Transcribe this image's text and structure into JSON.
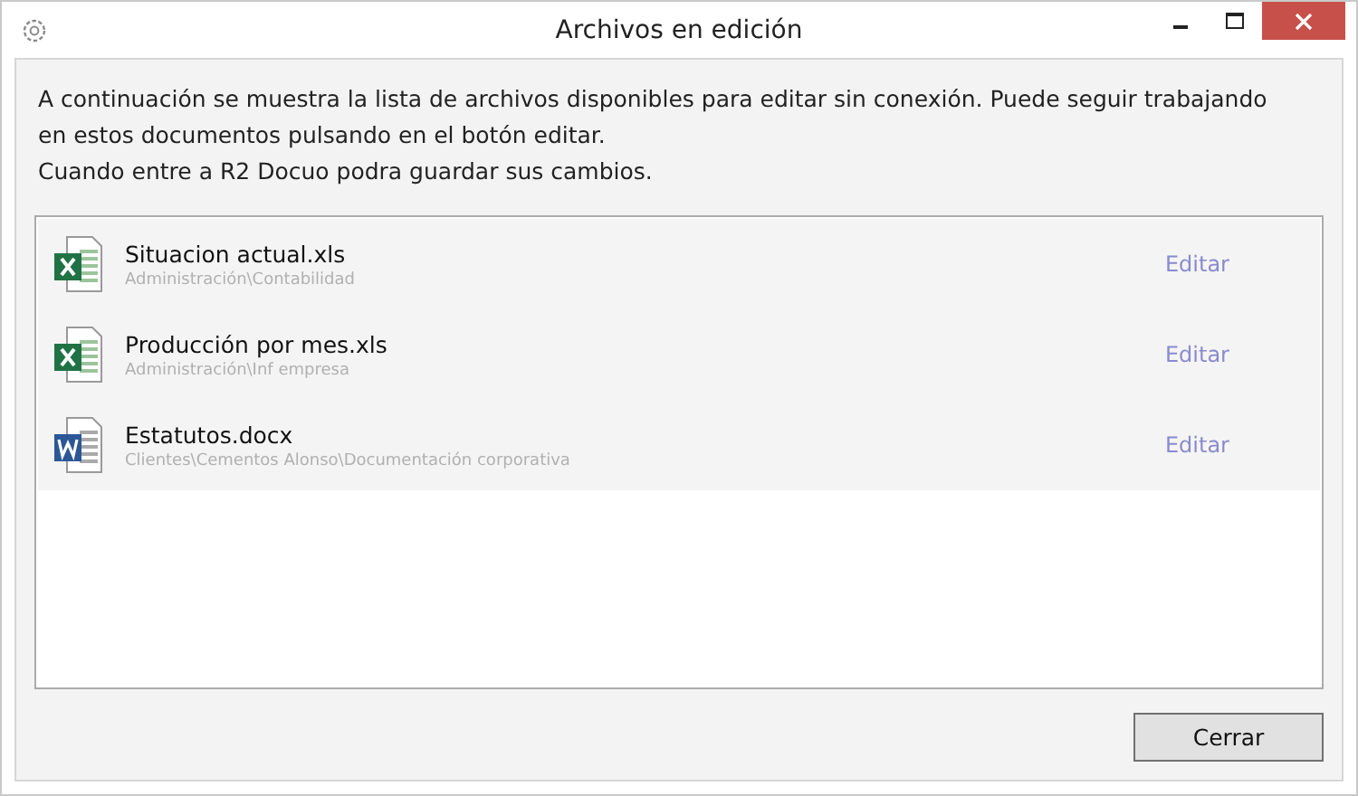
{
  "window": {
    "title": "Archivos en edición"
  },
  "intro": [
    "A continuación se muestra la lista de archivos disponibles para editar sin conexión. Puede seguir trabajando en estos documentos pulsando en el botón editar.",
    "Cuando entre a R2 Docuo podra guardar sus cambios."
  ],
  "files": [
    {
      "kind": "excel",
      "name": "Situacion actual.xls",
      "path": "Administración\\Contabilidad",
      "action": "Editar"
    },
    {
      "kind": "excel",
      "name": "Producción por mes.xls",
      "path": "Administración\\Inf empresa",
      "action": "Editar"
    },
    {
      "kind": "word",
      "name": "Estatutos.docx",
      "path": "Clientes\\Cementos Alonso\\Documentación corporativa",
      "action": "Editar"
    }
  ],
  "close_button": "Cerrar"
}
